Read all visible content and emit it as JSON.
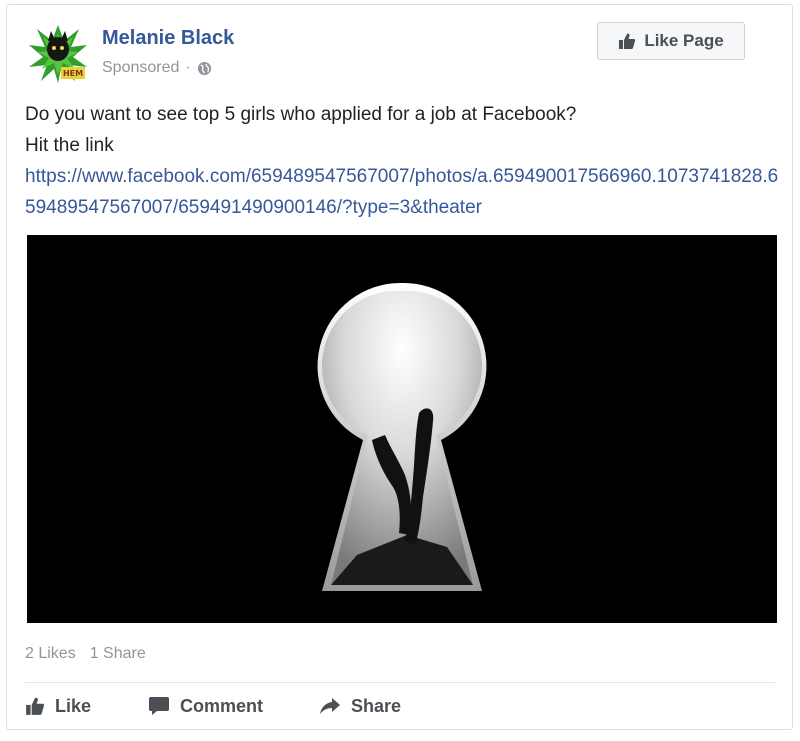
{
  "post": {
    "page_name": "Melanie Black",
    "sponsored_label": "Sponsored",
    "separator": "·",
    "audience_icon": "globe-icon",
    "avatar_text": "HEM",
    "like_page_label": "Like Page",
    "text_line1": "Do you want to see top 5 girls who applied for a job at Facebook?",
    "text_line2": "Hit the link",
    "link": "https://www.facebook.com/659489547567007/photos/a.659490017566960.1073741828.659489547567007/659491490900146/?type=3&theater"
  },
  "stats": {
    "likes": "2 Likes",
    "shares": "1 Share"
  },
  "actions": {
    "like": "Like",
    "comment": "Comment",
    "share": "Share"
  },
  "colors": {
    "name_blue": "#365899",
    "meta_gray": "#90949c",
    "action_gray": "#4b4f56",
    "image_bg": "#000000"
  }
}
